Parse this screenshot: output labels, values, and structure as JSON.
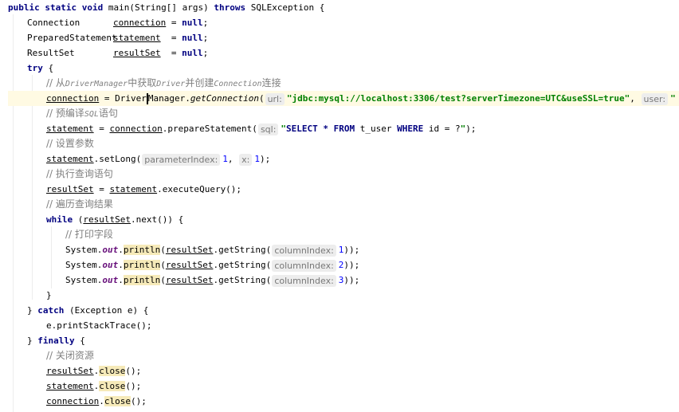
{
  "code": {
    "l1": {
      "kw_public": "public",
      "kw_static": "static",
      "kw_void": "void",
      "sig": " main(String[] args) ",
      "kw_throws": "throws",
      "exc": " SQLException {"
    },
    "l2": {
      "type": "Connection",
      "var": "connection",
      "eq": " = ",
      "kw_null": "null",
      "semi": ";"
    },
    "l3": {
      "type": "PreparedStatement",
      "var": "statement",
      "eq": "  = ",
      "kw_null": "null",
      "semi": ";"
    },
    "l4": {
      "type": "ResultSet",
      "var": "resultSet",
      "eq": "  = ",
      "kw_null": "null",
      "semi": ";"
    },
    "l5": {
      "kw_try": "try",
      "rest": " {"
    },
    "l6": {
      "c1": "// 从",
      "c2": "DriverManager",
      "c3": "中获取",
      "c4": "Driver",
      "c5": "并创建",
      "c6": "Connection",
      "c7": "连接"
    },
    "l7": {
      "var": "connection",
      "eq": " = ",
      "cls_a": "Driver",
      "cls_b": "Manager",
      "dot": ".",
      "method": "getConnection",
      "paren": "(",
      "hint_url": "url:",
      "str_url": "\"jdbc:mysql://localhost:3306/test?serverTimezone=UTC&useSSL=true\"",
      "comma": ",",
      "hint_user": "user:",
      "str_user": "\""
    },
    "l8": {
      "c1": "// 预编译",
      "c2": "SQL",
      "c3": "语句"
    },
    "l9": {
      "var": "statement",
      "eq": " = ",
      "obj": "connection",
      "call": ".prepareStatement(",
      "hint_sql": "sql:",
      "q1": "\"",
      "kw_select": "SELECT",
      "s1": " * ",
      "kw_from": "FROM",
      "s2": " t_user ",
      "kw_where": "WHERE",
      "s3": " id = ?",
      "q2": "\"",
      "end": ");"
    },
    "l10": {
      "comment": "// 设置参数"
    },
    "l11": {
      "var": "statement",
      "call": ".setLong(",
      "hint_pi": "parameterIndex:",
      "arg1": "1",
      "comma": ",",
      "hint_x": "x:",
      "arg2": "1",
      "end": ");"
    },
    "l12": {
      "comment": "// 执行查询语句"
    },
    "l13": {
      "var": "resultSet",
      "eq": " = ",
      "obj": "statement",
      "call": ".executeQuery();"
    },
    "l14": {
      "comment": "// 遍历查询结果"
    },
    "l15": {
      "kw_while": "while",
      "open": " (",
      "var": "resultSet",
      "call": ".next()) {"
    },
    "l16": {
      "comment": "// 打印字段"
    },
    "print_rows": [
      {
        "sys": "System.",
        "out": "out",
        "dot": ".",
        "println": "println",
        "open": "(",
        "var": "resultSet",
        "call": ".getString(",
        "hint": "columnIndex:",
        "arg": "1",
        "end": "));"
      },
      {
        "sys": "System.",
        "out": "out",
        "dot": ".",
        "println": "println",
        "open": "(",
        "var": "resultSet",
        "call": ".getString(",
        "hint": "columnIndex:",
        "arg": "2",
        "end": "));"
      },
      {
        "sys": "System.",
        "out": "out",
        "dot": ".",
        "println": "println",
        "open": "(",
        "var": "resultSet",
        "call": ".getString(",
        "hint": "columnIndex:",
        "arg": "3",
        "end": "));"
      }
    ],
    "l20": {
      "text": "}"
    },
    "l21": {
      "open": "} ",
      "kw_catch": "catch",
      "rest": " (Exception e) {"
    },
    "l22": {
      "text": "e.printStackTrace();"
    },
    "l23": {
      "open": "} ",
      "kw_finally": "finally",
      "rest": " {"
    },
    "l24": {
      "comment": "// 关闭资源"
    },
    "close_rows": [
      {
        "var": "resultSet",
        "dot": ".",
        "method": "close",
        "end": "();"
      },
      {
        "var": "statement",
        "dot": ".",
        "method": "close",
        "end": "();"
      },
      {
        "var": "connection",
        "dot": ".",
        "method": "close",
        "end": "();"
      }
    ],
    "l28": {
      "text": "}"
    }
  }
}
